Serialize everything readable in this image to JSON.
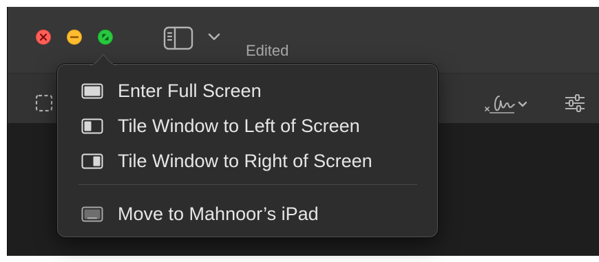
{
  "window": {
    "status": "Edited"
  },
  "titlebar": {
    "traffic_lights": [
      {
        "name": "close",
        "color": "#ff5f57"
      },
      {
        "name": "minimize",
        "color": "#febc2e"
      },
      {
        "name": "zoom",
        "color": "#28c840"
      }
    ],
    "sidebar_toggle_icon": "sidebar-icon",
    "sidebar_toggle_chevron": "chevron-down-icon"
  },
  "toolbar": {
    "tools": [
      {
        "icon": "dashed-selection-icon"
      },
      {
        "icon": "signature-icon"
      },
      {
        "icon": "sliders-icon"
      }
    ]
  },
  "menu": {
    "items": [
      {
        "label": "Enter Full Screen",
        "icon": "full-screen-icon"
      },
      {
        "label": "Tile Window to Left of Screen",
        "icon": "tile-left-icon"
      },
      {
        "label": "Tile Window to Right of Screen",
        "icon": "tile-right-icon"
      },
      {
        "label": "Move to Mahnoor’s iPad",
        "icon": "ipad-icon"
      }
    ]
  },
  "colors": {
    "titlebar": "#373737",
    "toolbar": "#333333",
    "menu_background": "#2d2d2d",
    "menu_text": "#e6e6e6"
  }
}
